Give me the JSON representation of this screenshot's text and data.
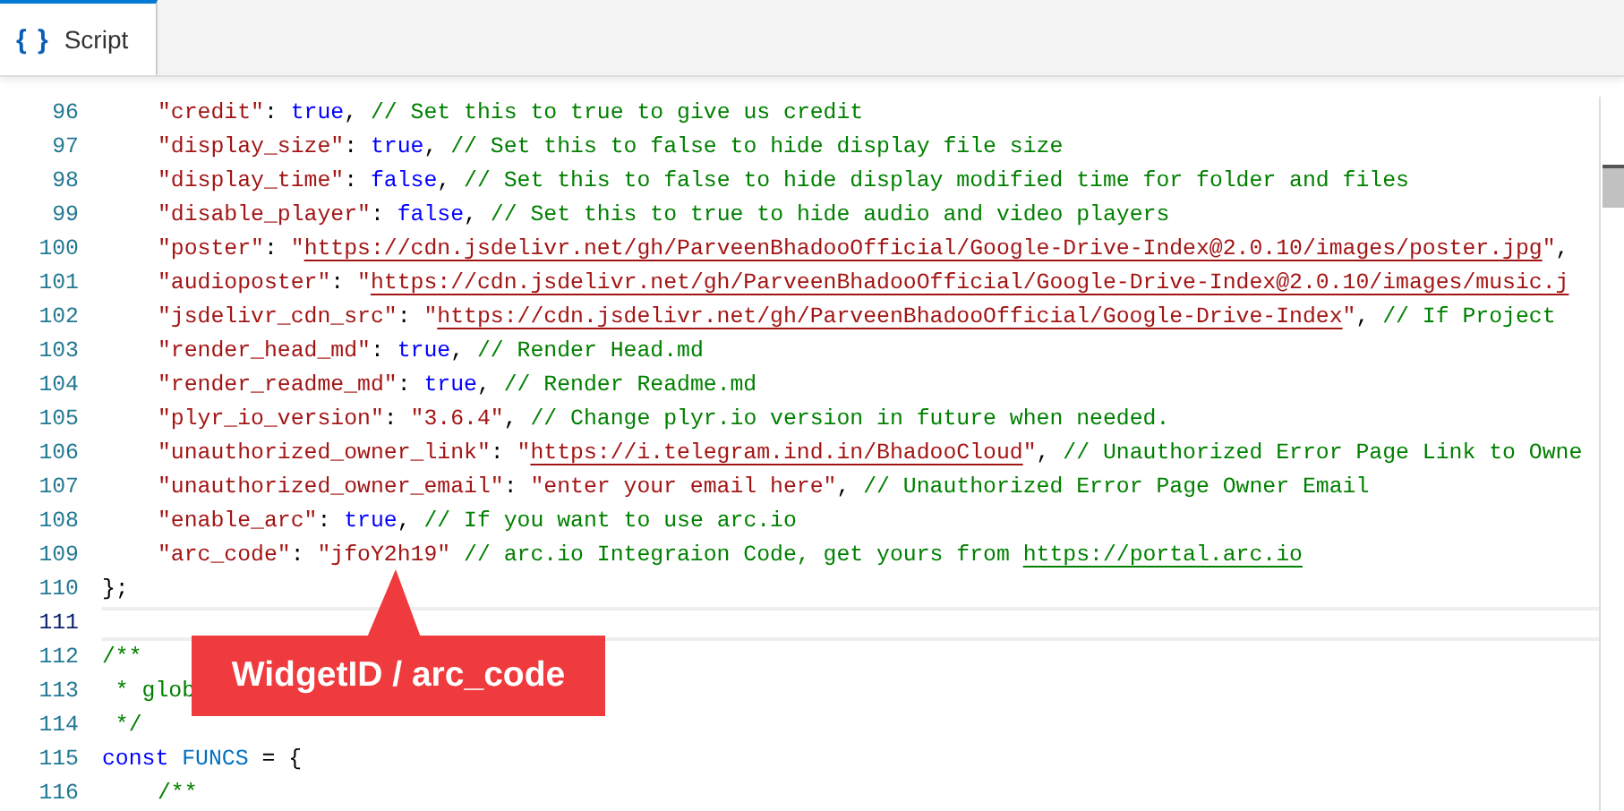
{
  "tabs": [
    {
      "icon": "{ }",
      "label": "Script",
      "selected": true
    }
  ],
  "editor": {
    "lines": [
      {
        "number": "96",
        "indented": true,
        "selected": false,
        "tokens": [
          {
            "kind": "str",
            "text": "\"credit\""
          },
          {
            "kind": "punct",
            "text": ": "
          },
          {
            "kind": "bool",
            "text": "true"
          },
          {
            "kind": "punct",
            "text": ", "
          },
          {
            "kind": "comment",
            "text": "// Set this to true to give us credit"
          }
        ]
      },
      {
        "number": "97",
        "indented": true,
        "selected": false,
        "tokens": [
          {
            "kind": "str",
            "text": "\"display_size\""
          },
          {
            "kind": "punct",
            "text": ": "
          },
          {
            "kind": "bool",
            "text": "true"
          },
          {
            "kind": "punct",
            "text": ", "
          },
          {
            "kind": "comment",
            "text": "// Set this to false to hide display file size"
          }
        ]
      },
      {
        "number": "98",
        "indented": true,
        "selected": false,
        "tokens": [
          {
            "kind": "str",
            "text": "\"display_time\""
          },
          {
            "kind": "punct",
            "text": ": "
          },
          {
            "kind": "bool",
            "text": "false"
          },
          {
            "kind": "punct",
            "text": ", "
          },
          {
            "kind": "comment",
            "text": "// Set this to false to hide display modified time for folder and files"
          }
        ]
      },
      {
        "number": "99",
        "indented": true,
        "selected": false,
        "tokens": [
          {
            "kind": "str",
            "text": "\"disable_player\""
          },
          {
            "kind": "punct",
            "text": ": "
          },
          {
            "kind": "bool",
            "text": "false"
          },
          {
            "kind": "punct",
            "text": ", "
          },
          {
            "kind": "comment",
            "text": "// Set this to true to hide audio and video players"
          }
        ]
      },
      {
        "number": "100",
        "indented": true,
        "selected": false,
        "tokens": [
          {
            "kind": "str",
            "text": "\"poster\""
          },
          {
            "kind": "punct",
            "text": ": "
          },
          {
            "kind": "str",
            "text": "\""
          },
          {
            "kind": "url",
            "text": "https://cdn.jsdelivr.net/gh/ParveenBhadooOfficial/Google-Drive-Index@2.0.10/images/poster.jpg"
          },
          {
            "kind": "str",
            "text": "\""
          },
          {
            "kind": "punct",
            "text": ","
          }
        ]
      },
      {
        "number": "101",
        "indented": true,
        "selected": false,
        "tokens": [
          {
            "kind": "str",
            "text": "\"audioposter\""
          },
          {
            "kind": "punct",
            "text": ": "
          },
          {
            "kind": "str",
            "text": "\""
          },
          {
            "kind": "url",
            "text": "https://cdn.jsdelivr.net/gh/ParveenBhadooOfficial/Google-Drive-Index@2.0.10/images/music.j"
          }
        ]
      },
      {
        "number": "102",
        "indented": true,
        "selected": false,
        "tokens": [
          {
            "kind": "str",
            "text": "\"jsdelivr_cdn_src\""
          },
          {
            "kind": "punct",
            "text": ": "
          },
          {
            "kind": "str",
            "text": "\""
          },
          {
            "kind": "url",
            "text": "https://cdn.jsdelivr.net/gh/ParveenBhadooOfficial/Google-Drive-Index"
          },
          {
            "kind": "str",
            "text": "\""
          },
          {
            "kind": "punct",
            "text": ", "
          },
          {
            "kind": "comment",
            "text": "// If Project"
          }
        ]
      },
      {
        "number": "103",
        "indented": true,
        "selected": false,
        "tokens": [
          {
            "kind": "str",
            "text": "\"render_head_md\""
          },
          {
            "kind": "punct",
            "text": ": "
          },
          {
            "kind": "bool",
            "text": "true"
          },
          {
            "kind": "punct",
            "text": ", "
          },
          {
            "kind": "comment",
            "text": "// Render Head.md"
          }
        ]
      },
      {
        "number": "104",
        "indented": true,
        "selected": false,
        "tokens": [
          {
            "kind": "str",
            "text": "\"render_readme_md\""
          },
          {
            "kind": "punct",
            "text": ": "
          },
          {
            "kind": "bool",
            "text": "true"
          },
          {
            "kind": "punct",
            "text": ", "
          },
          {
            "kind": "comment",
            "text": "// Render Readme.md"
          }
        ]
      },
      {
        "number": "105",
        "indented": true,
        "selected": false,
        "tokens": [
          {
            "kind": "str",
            "text": "\"plyr_io_version\""
          },
          {
            "kind": "punct",
            "text": ": "
          },
          {
            "kind": "str",
            "text": "\"3.6.4\""
          },
          {
            "kind": "punct",
            "text": ", "
          },
          {
            "kind": "comment",
            "text": "// Change plyr.io version in future when needed."
          }
        ]
      },
      {
        "number": "106",
        "indented": true,
        "selected": false,
        "tokens": [
          {
            "kind": "str",
            "text": "\"unauthorized_owner_link\""
          },
          {
            "kind": "punct",
            "text": ": "
          },
          {
            "kind": "str",
            "text": "\""
          },
          {
            "kind": "url",
            "text": "https://i.telegram.ind.in/BhadooCloud"
          },
          {
            "kind": "str",
            "text": "\""
          },
          {
            "kind": "punct",
            "text": ", "
          },
          {
            "kind": "comment",
            "text": "// Unauthorized Error Page Link to Owne"
          }
        ]
      },
      {
        "number": "107",
        "indented": true,
        "selected": false,
        "tokens": [
          {
            "kind": "str",
            "text": "\"unauthorized_owner_email\""
          },
          {
            "kind": "punct",
            "text": ": "
          },
          {
            "kind": "str",
            "text": "\"enter your email here\""
          },
          {
            "kind": "punct",
            "text": ", "
          },
          {
            "kind": "comment",
            "text": "// Unauthorized Error Page Owner Email"
          }
        ]
      },
      {
        "number": "108",
        "indented": true,
        "selected": false,
        "tokens": [
          {
            "kind": "str",
            "text": "\"enable_arc\""
          },
          {
            "kind": "punct",
            "text": ": "
          },
          {
            "kind": "bool",
            "text": "true"
          },
          {
            "kind": "punct",
            "text": ", "
          },
          {
            "kind": "comment",
            "text": "// If you want to use arc.io"
          }
        ]
      },
      {
        "number": "109",
        "indented": true,
        "selected": false,
        "tokens": [
          {
            "kind": "str",
            "text": "\"arc_code\""
          },
          {
            "kind": "punct",
            "text": ": "
          },
          {
            "kind": "str",
            "text": "\"jfoY2h19\""
          },
          {
            "kind": "comment",
            "text": " // arc.io Integraion Code, get yours from "
          },
          {
            "kind": "comment-link",
            "text": "https://portal.arc.io"
          }
        ]
      },
      {
        "number": "110",
        "indented": false,
        "selected": false,
        "tokens": [
          {
            "kind": "punct",
            "text": "};"
          }
        ]
      },
      {
        "number": "111",
        "indented": false,
        "selected": true
      },
      {
        "number": "112",
        "indented": false,
        "selected": false,
        "tokens": [
          {
            "kind": "comment",
            "text": "/**"
          }
        ]
      },
      {
        "number": "113",
        "indented": false,
        "selected": false,
        "tokens": [
          {
            "kind": "comment",
            "text": " * glob"
          }
        ]
      },
      {
        "number": "114",
        "indented": false,
        "selected": false,
        "tokens": [
          {
            "kind": "comment",
            "text": " */"
          }
        ]
      },
      {
        "number": "115",
        "indented": false,
        "selected": false,
        "tokens": [
          {
            "kind": "keyword",
            "text": "const"
          },
          {
            "kind": "ident",
            "text": " FUNCS"
          },
          {
            "kind": "punct",
            "text": " = {"
          }
        ]
      },
      {
        "number": "116",
        "indented": true,
        "selected": false,
        "tokens": [
          {
            "kind": "comment",
            "text": "/**"
          }
        ]
      }
    ]
  },
  "callout": {
    "text": "WidgetID / arc_code"
  }
}
